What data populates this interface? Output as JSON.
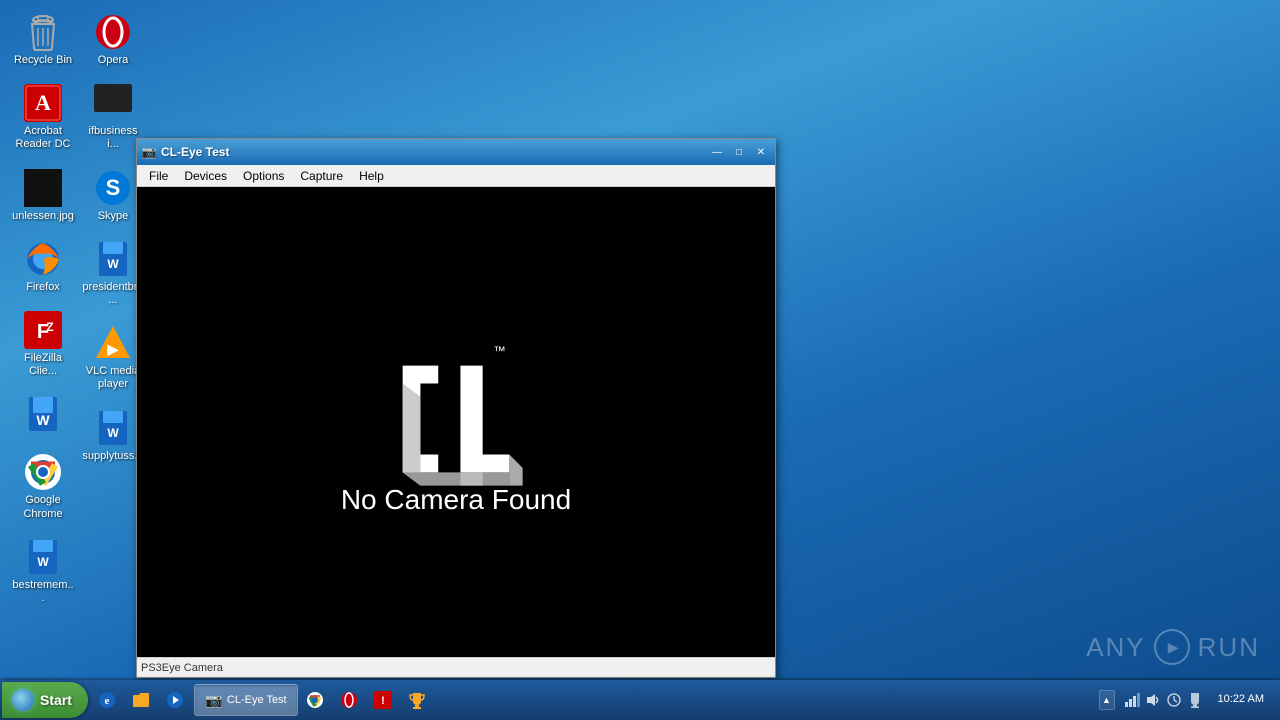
{
  "desktop": {
    "icons": [
      {
        "id": "recycle-bin",
        "label": "Recycle Bin",
        "icon": "recycle"
      },
      {
        "id": "acrobat-reader-dc",
        "label": "Acrobat Reader DC",
        "icon": "acrobat"
      },
      {
        "id": "unlessen-jpg",
        "label": "unlessen.jpg",
        "icon": "image"
      },
      {
        "id": "firefox",
        "label": "Firefox",
        "icon": "firefox"
      },
      {
        "id": "filezilla-client",
        "label": "FileZilla Clie...",
        "icon": "filezilla"
      },
      {
        "id": "word-doc",
        "label": "",
        "icon": "word"
      },
      {
        "id": "google-chrome",
        "label": "Google Chrome",
        "icon": "chrome"
      },
      {
        "id": "bestremem",
        "label": "bestremem...",
        "icon": "word-blue"
      },
      {
        "id": "opera",
        "label": "Opera",
        "icon": "opera"
      },
      {
        "id": "ifbusiness",
        "label": "ifbusiness i...",
        "icon": "black"
      },
      {
        "id": "skype",
        "label": "Skype",
        "icon": "skype"
      },
      {
        "id": "presidentbra",
        "label": "presidentbra...",
        "icon": "word-blue"
      },
      {
        "id": "vlc-media-player",
        "label": "VLC media player",
        "icon": "vlc"
      },
      {
        "id": "supplytuss",
        "label": "supplytuss...",
        "icon": "word-blue"
      }
    ]
  },
  "window": {
    "title": "CL-Eye Test",
    "title_icon": "📷",
    "menus": [
      "File",
      "Devices",
      "Options",
      "Capture",
      "Help"
    ],
    "content": {
      "logo_tm": "™",
      "no_camera_text": "No Camera Found"
    },
    "statusbar": "PS3Eye Camera",
    "controls": {
      "minimize": "—",
      "maximize": "□",
      "close": "✕"
    }
  },
  "taskbar": {
    "start_label": "Start",
    "items": [
      {
        "id": "cl-eye-task",
        "label": "CL-Eye Test",
        "icon": "📷",
        "active": true
      }
    ],
    "tray": {
      "expand_label": "▲",
      "icons": [
        {
          "id": "network-icon",
          "symbol": "🖥"
        },
        {
          "id": "sound-icon",
          "symbol": "🔊"
        },
        {
          "id": "time-sync-icon",
          "symbol": "⏰"
        },
        {
          "id": "trophy-icon",
          "symbol": "🏆"
        }
      ],
      "time": "10:22 AM"
    }
  },
  "anyrun": {
    "text": "ANY",
    "play_symbol": "▶",
    "run_text": "RUN"
  }
}
